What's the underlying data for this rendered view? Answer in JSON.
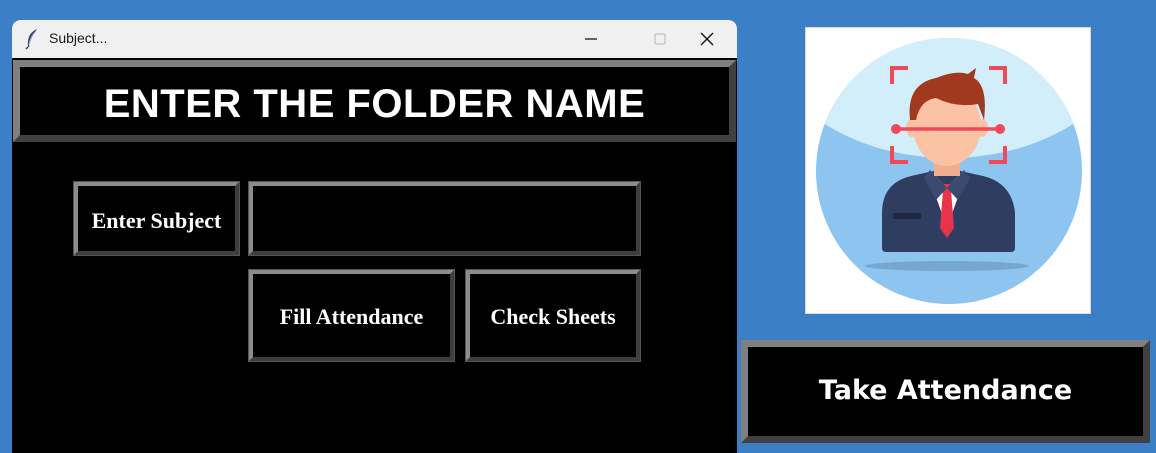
{
  "window": {
    "title": "Subject...",
    "icon": "feather-icon",
    "controls": [
      "minimize-icon",
      "maximize-icon",
      "close-icon"
    ]
  },
  "form": {
    "header": "ENTER THE FOLDER NAME",
    "subject_label": "Enter Subject",
    "subject_value": "",
    "fill_attendance_label": "Fill Attendance",
    "check_sheets_label": "Check Sheets"
  },
  "main": {
    "image": "face-recognition-illustration",
    "take_attendance_label": "Take Attendance"
  },
  "colors": {
    "desktop": "#3b7fc6",
    "window_bg": "#000000",
    "button_text": "#ffffff",
    "bevel_light": "#808080",
    "bevel_dark": "#404040"
  }
}
